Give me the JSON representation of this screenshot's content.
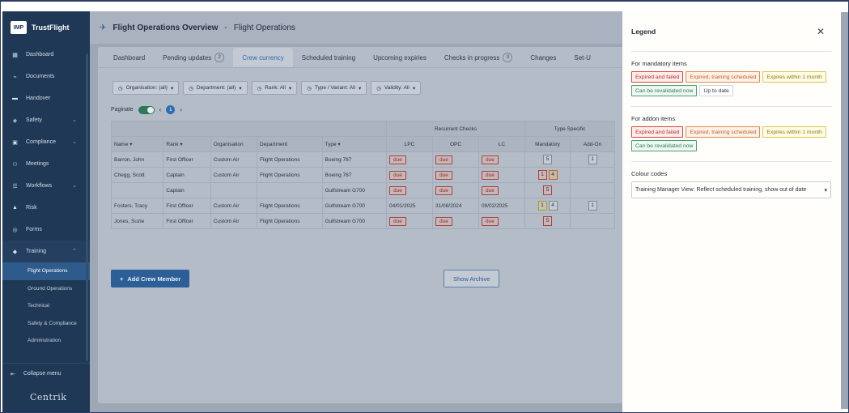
{
  "brand": {
    "logo_text": "IMP",
    "name": "TrustFlight"
  },
  "sidebar": {
    "items": [
      {
        "label": "Dashboard",
        "icon": "dashboard-icon",
        "glyph": "▦",
        "chevron": false
      },
      {
        "label": "Documents",
        "icon": "paperclip-icon",
        "glyph": "⌁",
        "chevron": false
      },
      {
        "label": "Handover",
        "icon": "handover-icon",
        "glyph": "▬",
        "chevron": false
      },
      {
        "label": "Safety",
        "icon": "shield-icon",
        "glyph": "◈",
        "chevron": true
      },
      {
        "label": "Compliance",
        "icon": "compliance-icon",
        "glyph": "▣",
        "chevron": true
      },
      {
        "label": "Meetings",
        "icon": "meetings-icon",
        "glyph": "⚇",
        "chevron": false
      },
      {
        "label": "Workflows",
        "icon": "workflows-icon",
        "glyph": "☰",
        "chevron": true
      },
      {
        "label": "Risk",
        "icon": "risk-icon",
        "glyph": "▲",
        "chevron": false
      },
      {
        "label": "Forms",
        "icon": "forms-icon",
        "glyph": "◎",
        "chevron": false
      },
      {
        "label": "Training",
        "icon": "graduation-cap-icon",
        "glyph": "◆",
        "chevron": true
      }
    ],
    "training_sub": [
      "Flight Operations",
      "Ground Operations",
      "Technical",
      "Safety & Compliance",
      "Administration"
    ],
    "collapse_label": "Collapse menu",
    "footer_logo": "Centrik"
  },
  "header": {
    "title": "Flight Operations Overview",
    "separator": "-",
    "crumb": "Flight Operations"
  },
  "tabs": [
    {
      "label": "Dashboard",
      "count": null
    },
    {
      "label": "Pending updates",
      "count": "2"
    },
    {
      "label": "Crew currency",
      "count": null
    },
    {
      "label": "Scheduled training",
      "count": null
    },
    {
      "label": "Upcoming expiries",
      "count": null
    },
    {
      "label": "Checks in progress",
      "count": "3"
    },
    {
      "label": "Changes",
      "count": null
    },
    {
      "label": "Set-U",
      "count": null
    }
  ],
  "filters": [
    {
      "label": "Organisation: (all)"
    },
    {
      "label": "Department: (all)"
    },
    {
      "label": "Rank: All"
    },
    {
      "label": "Type / Variant: All"
    },
    {
      "label": "Validity: All"
    }
  ],
  "paginate": {
    "label": "Paginate",
    "page": "1"
  },
  "table": {
    "group_headers": {
      "recurrent": "Recurrent Checks",
      "type_specific": "Type Specific"
    },
    "columns": [
      "Name",
      "Rank",
      "Organisation",
      "Department",
      "Type",
      "LPC",
      "OPC",
      "LC",
      "Mandatory",
      "Add-On"
    ],
    "rows": [
      {
        "name": "Barron, John",
        "rank": "First Officer",
        "org": "Custom Air",
        "dept": "Flight Operations",
        "type": "Boeing 787",
        "lpc": "due",
        "opc": "due",
        "lc": "due",
        "mandatory": [
          {
            "v": "5",
            "c": "plain"
          }
        ],
        "addon": [
          {
            "v": "1",
            "c": "plain"
          }
        ]
      },
      {
        "name": "Chegg, Scott",
        "rank": "Captain",
        "org": "Custom Air",
        "dept": "Flight Operations",
        "type": "Boeing 787",
        "lpc": "due",
        "opc": "due",
        "lc": "due",
        "mandatory": [
          {
            "v": "1",
            "c": "red"
          },
          {
            "v": "4",
            "c": "orange"
          }
        ],
        "addon": []
      },
      {
        "name": "",
        "rank": "Captain",
        "org": "",
        "dept": "",
        "type": "Gulfstream G700",
        "lpc": "due",
        "opc": "due",
        "lc": "due",
        "mandatory": [
          {
            "v": "5",
            "c": "red"
          }
        ],
        "addon": []
      },
      {
        "name": "Fosters, Tracy",
        "rank": "First Officer",
        "org": "Custom Air",
        "dept": "Flight Operations",
        "type": "Gulfstream G700",
        "lpc": "04/01/2025",
        "opc": "31/08/2024",
        "lc": "09/02/2025",
        "mandatory": [
          {
            "v": "1",
            "c": "yellow"
          },
          {
            "v": "4",
            "c": "plain"
          }
        ],
        "addon": [
          {
            "v": "1",
            "c": "plain"
          }
        ]
      },
      {
        "name": "Jones, Suzie",
        "rank": "First Officer",
        "org": "Custom Air",
        "dept": "Flight Operations",
        "type": "Gulfstream G700",
        "lpc": "due",
        "opc": "due",
        "lc": "due",
        "mandatory": [
          {
            "v": "5",
            "c": "red"
          }
        ],
        "addon": []
      }
    ]
  },
  "buttons": {
    "add_crew": "Add Crew Member",
    "show_archive": "Show Archive"
  },
  "legend": {
    "title": "Legend",
    "mandatory_title": "For mandatory items",
    "mandatory_chips": [
      {
        "label": "Expired and failed",
        "c": "red"
      },
      {
        "label": "Expired, training scheduled",
        "c": "orange"
      },
      {
        "label": "Expires within 1 month",
        "c": "yellow"
      },
      {
        "label": "Can be revalidated now",
        "c": "green"
      },
      {
        "label": "Up to date",
        "c": "plain"
      }
    ],
    "addon_title": "For addon items",
    "addon_chips": [
      {
        "label": "Expired and failed",
        "c": "red"
      },
      {
        "label": "Expired, training scheduled",
        "c": "orange"
      },
      {
        "label": "Expires within 1 month",
        "c": "yellow"
      },
      {
        "label": "Can be revalidated now",
        "c": "green"
      }
    ],
    "colour_title": "Colour codes",
    "colour_select": "Training Manager View: Reflect scheduled training, show out of date"
  },
  "colors": {
    "sidebar": "#1e3855",
    "accent": "#2f6bb0",
    "highlight": "#e04a43"
  }
}
